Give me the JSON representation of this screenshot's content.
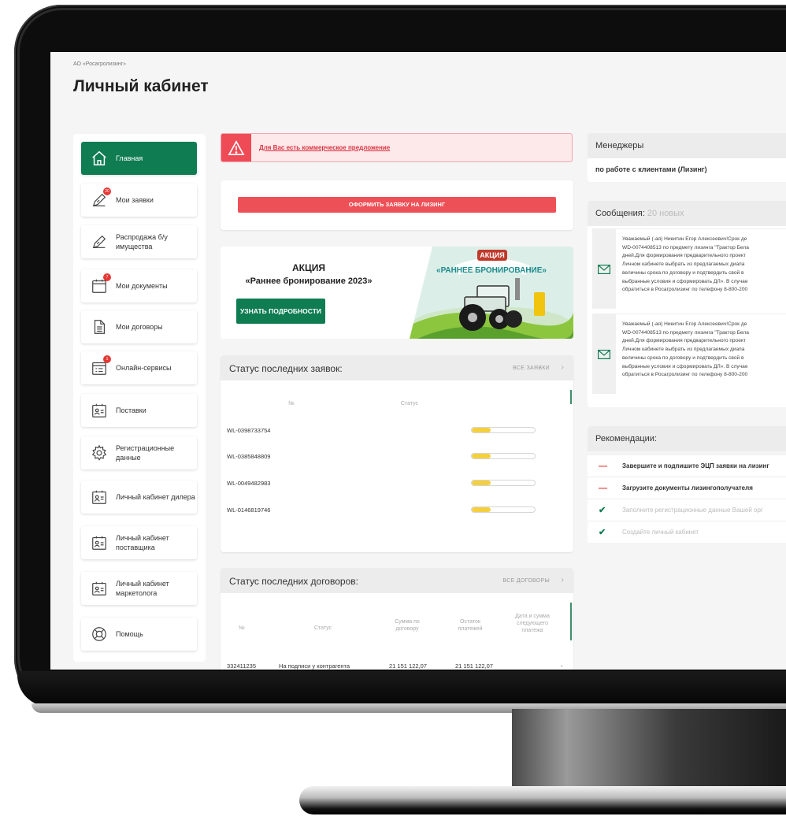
{
  "breadcrumb": "АО «Росагролизинг»",
  "page_title": "Личный кабинет",
  "colors": {
    "brand_green": "#0f7c52",
    "alert_red": "#ee4b57",
    "progress_yellow": "#f4d03f"
  },
  "sidebar": {
    "items": [
      {
        "label": "Главная",
        "icon": "home-icon",
        "active": true
      },
      {
        "label": "Мои заявки",
        "icon": "edit-document-icon",
        "badge": "20"
      },
      {
        "label": "Распродажа б/у имущества",
        "icon": "edit-document-icon"
      },
      {
        "label": "Мои документы",
        "icon": "calendar-icon",
        "badge": "7"
      },
      {
        "label": "Мои договоры",
        "icon": "document-icon"
      },
      {
        "label": "Онлайн-сервисы",
        "icon": "calendar-list-icon",
        "badge": "1"
      },
      {
        "label": "Поставки",
        "icon": "contact-card-icon"
      },
      {
        "label": "Регистрационные данные",
        "icon": "gear-icon"
      },
      {
        "label": "Личный кабинет дилера",
        "icon": "contact-card-icon"
      },
      {
        "label": "Личный кабинет поставщика",
        "icon": "contact-card-icon"
      },
      {
        "label": "Личный кабинет маркетолога",
        "icon": "contact-card-icon"
      },
      {
        "label": "Помощь",
        "icon": "lifebuoy-icon"
      }
    ]
  },
  "alert": {
    "icon": "warning-icon",
    "link_text": "Для Вас есть коммерческое предложение"
  },
  "lease_button": "ОФОРМИТЬ ЗАЯВКУ НА ЛИЗИНГ",
  "promo": {
    "title": "АКЦИЯ",
    "subtitle": "«Раннее бронирование 2023»",
    "button": "УЗНАТЬ ПОДРОБНОСТИ",
    "badge_text": "АКЦИЯ",
    "art_text": "«РАННЕЕ БРОНИРОВАНИЕ»"
  },
  "applications": {
    "title": "Статус последних заявок:",
    "all_link": "ВСЕ ЗАЯВКИ",
    "columns": [
      "№",
      "Статус"
    ],
    "rows": [
      {
        "number": "WL-0398733754",
        "progress": 0.3
      },
      {
        "number": "WL-0385848809",
        "progress": 0.3
      },
      {
        "number": "WL-0049482983",
        "progress": 0.3
      },
      {
        "number": "WL-0146819746",
        "progress": 0.3
      }
    ]
  },
  "contracts": {
    "title": "Статус последних договоров:",
    "all_link": "ВСЕ ДОГОВОРЫ",
    "columns": [
      "№",
      "Статус",
      "Сумма по договору",
      "Остаток платежей",
      "Дата и сумма следующего платежа"
    ],
    "rows": [
      {
        "number": "332411235",
        "status": "На подписи у контрагента",
        "sum": "21 151 122,07",
        "remaining": "21 151 122,07",
        "next": "-"
      }
    ]
  },
  "managers": {
    "title": "Менеджеры",
    "subtitle": "по работе с клиентами (Лизинг)"
  },
  "messages": {
    "title": "Сообщения:",
    "count": "20 новых",
    "items": [
      {
        "icon": "envelope-icon",
        "lines": [
          "Уважаемый (-ая) Никитин Егор Алексеевич!Срок де",
          "WD-0074408513 по предмету лизинга \"Трактор Бела",
          "дней.Для формирования предварительного проект",
          "Личном кабинете выбрать из предлагаемых диапа",
          "величины срока по договору и подтвердить свой в",
          "выбранные условия и сформировать ДЛ». В случае",
          "обратиться в Росагролизинг по телефону 8-800-200"
        ]
      },
      {
        "icon": "envelope-icon",
        "lines": [
          "Уважаемый (-ая) Никитин Егор Алексеевич!Срок де",
          "WD-0074408513 по предмету лизинга \"Трактор Бела",
          "дней.Для формирования предварительного проект",
          "Личном кабинете выбрать из предлагаемых диапа",
          "величины срока по договору и подтвердить свой в",
          "выбранные условия и сформировать ДЛ». В случае",
          "обратиться в Росагролизинг по телефону 8-800-200"
        ]
      }
    ]
  },
  "recommendations": {
    "title": "Рекомендации:",
    "items": [
      {
        "text": "Завершите и подпишите ЭЦП заявки на лизинг",
        "done": false,
        "mark": "—"
      },
      {
        "text": "Загрузите документы лизингополучателя",
        "done": false,
        "mark": "—"
      },
      {
        "text": "Заполните регистрационные данные Вашей орг",
        "done": true,
        "mark": "✔"
      },
      {
        "text": "Создайте личный кабинет",
        "done": true,
        "mark": "✔"
      }
    ]
  }
}
